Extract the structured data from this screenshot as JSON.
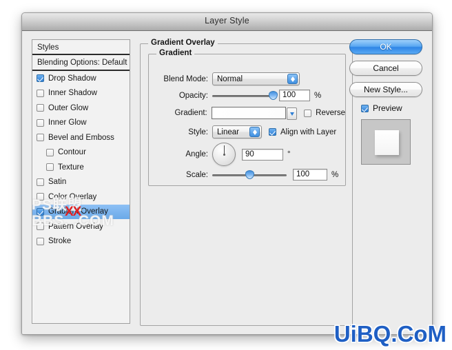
{
  "window": {
    "title": "Layer Style"
  },
  "styles_panel": {
    "header": "Styles",
    "blending_options": "Blending Options: Default",
    "items": [
      {
        "label": "Drop Shadow",
        "checked": true,
        "indent": false,
        "selected": false
      },
      {
        "label": "Inner Shadow",
        "checked": false,
        "indent": false,
        "selected": false
      },
      {
        "label": "Outer Glow",
        "checked": false,
        "indent": false,
        "selected": false
      },
      {
        "label": "Inner Glow",
        "checked": false,
        "indent": false,
        "selected": false
      },
      {
        "label": "Bevel and Emboss",
        "checked": false,
        "indent": false,
        "selected": false
      },
      {
        "label": "Contour",
        "checked": false,
        "indent": true,
        "selected": false
      },
      {
        "label": "Texture",
        "checked": false,
        "indent": true,
        "selected": false
      },
      {
        "label": "Satin",
        "checked": false,
        "indent": false,
        "selected": false
      },
      {
        "label": "Color Overlay",
        "checked": false,
        "indent": false,
        "selected": false
      },
      {
        "label": "Gradient Overlay",
        "checked": true,
        "indent": false,
        "selected": true
      },
      {
        "label": "Pattern Overlay",
        "checked": false,
        "indent": false,
        "selected": false
      },
      {
        "label": "Stroke",
        "checked": false,
        "indent": false,
        "selected": false
      }
    ]
  },
  "panel": {
    "group_title": "Gradient Overlay",
    "subgroup_title": "Gradient",
    "blend_mode": {
      "label": "Blend Mode:",
      "value": "Normal"
    },
    "opacity": {
      "label": "Opacity:",
      "value": "100",
      "unit": "%",
      "percent": 100
    },
    "gradient": {
      "label": "Gradient:",
      "reverse_label": "Reverse",
      "reverse_checked": false
    },
    "style": {
      "label": "Style:",
      "value": "Linear",
      "align_label": "Align with Layer",
      "align_checked": true
    },
    "angle": {
      "label": "Angle:",
      "value": "90",
      "unit": "°",
      "degrees": 90
    },
    "scale": {
      "label": "Scale:",
      "value": "100",
      "unit": "%",
      "percent": 50
    }
  },
  "buttons": {
    "ok": "OK",
    "cancel": "Cancel",
    "new_style": "New Style...",
    "preview_label": "Preview",
    "preview_checked": true
  },
  "watermarks": {
    "left_line1": "PS联盟",
    "left_line2": "BBS.       .COM",
    "xx": "XX",
    "right": "UiBQ.CoM"
  },
  "colors": {
    "accent_blue": "#2f7fd4",
    "selection_blue": "#7cb5f0",
    "window_bg": "#ececec",
    "watermark_blue": "#1f5fc4",
    "watermark_red": "#e02020"
  }
}
